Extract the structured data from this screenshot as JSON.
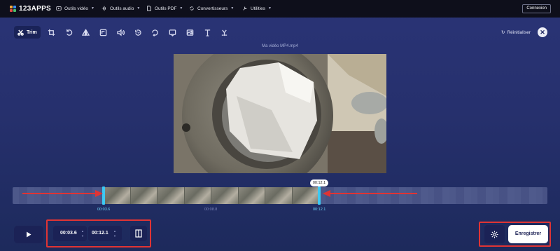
{
  "brand": {
    "name": "123APPS"
  },
  "nav": [
    {
      "label": "Outils vidéo",
      "icon": "video-icon"
    },
    {
      "label": "Outils audio",
      "icon": "audio-icon"
    },
    {
      "label": "Outils PDF",
      "icon": "pdf-icon"
    },
    {
      "label": "Convertisseurs",
      "icon": "convert-icon"
    },
    {
      "label": "Utilities",
      "icon": "utilities-icon"
    }
  ],
  "login_label": "Connexion",
  "toolbar": {
    "trim_label": "Trim",
    "reset_label": "Réinitialiser",
    "tools": [
      "crop-icon",
      "rotate-icon",
      "flip-icon",
      "resize-icon",
      "volume-icon",
      "speed-icon",
      "loop-icon",
      "stabilize-icon",
      "image-icon",
      "text-icon",
      "more-icon"
    ]
  },
  "file_name": "Ma vidéo MP4.mp4",
  "timeline": {
    "start_label": "00:03.6",
    "mid_label": "00:08.8",
    "end_label": "00:12.1",
    "badge": "00:12.1"
  },
  "controls": {
    "start_time": "00:03.6",
    "end_time": "00:12.1",
    "save_label": "Enregistrer"
  },
  "colors": {
    "accent": "#3dc9f3",
    "highlight": "#e03434",
    "bg": "#26306d"
  }
}
